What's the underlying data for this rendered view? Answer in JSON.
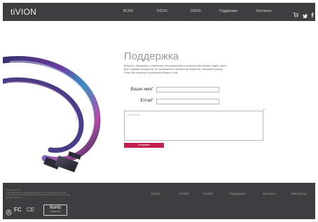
{
  "header": {
    "logo": "tiVION",
    "nav": [
      {
        "label": "B1100"
      },
      {
        "label": "D2100"
      },
      {
        "label": "D4100"
      },
      {
        "label": "Поддержка"
      },
      {
        "label": "Контакты"
      }
    ],
    "icons": [
      "cart-icon",
      "twitter-icon",
      "facebook-icon"
    ]
  },
  "hero": {
    "icon": "hdmi-cable-image"
  },
  "main": {
    "title": "Поддержка",
    "intro_lines": [
      "Вопросы, связанные с сервисным обслуживанием и ремонтом Вы можете задать здесь.",
      "Для отправки сообщения, не касающегося технических вопросов, заполните форму.",
      "Ответ Вы получите на указанный Вами e-mail."
    ],
    "form": {
      "name_label": "Ваше имя",
      "email_label": "Email",
      "required_mark": "*",
      "message_placeholder": "Сообщение",
      "submit_label": "Отправить"
    }
  },
  "footer": {
    "legal_lines": [
      "Ascendant is INC",
      "© 2013 TiVION is a registered trademark of Vish Data Enterprise LTD.",
      "16 /F, Wkermsly Central Building, 89 Lockhart Road, Wanchai, Hong Kong",
      "All rights reserved."
    ],
    "nav": [
      {
        "label": "B1100"
      },
      {
        "label": "D2100"
      },
      {
        "label": "D4100"
      },
      {
        "label": "Поддержка"
      },
      {
        "label": "Контакты"
      },
      {
        "label": "Магазины"
      }
    ],
    "certs": {
      "fc": "FC",
      "ce": "CE",
      "rohs": "RoHS",
      "rohs_sub": "COMPLIANT"
    }
  },
  "colors": {
    "header_bg": "#3e3e40",
    "accent": "#c21f4b",
    "title": "#9a9a9a"
  }
}
